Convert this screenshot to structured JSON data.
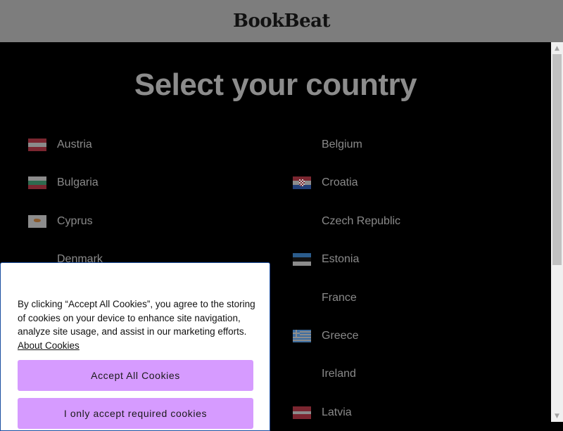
{
  "header": {
    "logo": "BookBeat"
  },
  "main": {
    "title": "Select your country",
    "countries_left": [
      {
        "name": "Austria",
        "flag": "austria"
      },
      {
        "name": "Bulgaria",
        "flag": "bulgaria"
      },
      {
        "name": "Cyprus",
        "flag": "cyprus"
      },
      {
        "name": "Denmark",
        "flag": ""
      }
    ],
    "countries_right": [
      {
        "name": "Belgium",
        "flag": ""
      },
      {
        "name": "Croatia",
        "flag": "croatia"
      },
      {
        "name": "Czech Republic",
        "flag": ""
      },
      {
        "name": "Estonia",
        "flag": "estonia"
      },
      {
        "name": "France",
        "flag": ""
      },
      {
        "name": "Greece",
        "flag": "greece"
      },
      {
        "name": "Ireland",
        "flag": ""
      },
      {
        "name": "Latvia",
        "flag": "latvia"
      }
    ]
  },
  "cookie_banner": {
    "text": "By clicking “Accept All Cookies”, you agree to the storing of cookies on your device to enhance site navigation, analyze site usage, and assist in our marketing efforts.",
    "link": "About Cookies",
    "accept_all": "Accept All Cookies",
    "accept_required": "I only accept required cookies",
    "button_color": "#d69bff"
  },
  "scrollbar": {
    "up_icon": "arrow-up-icon",
    "down_icon": "arrow-down-icon"
  }
}
